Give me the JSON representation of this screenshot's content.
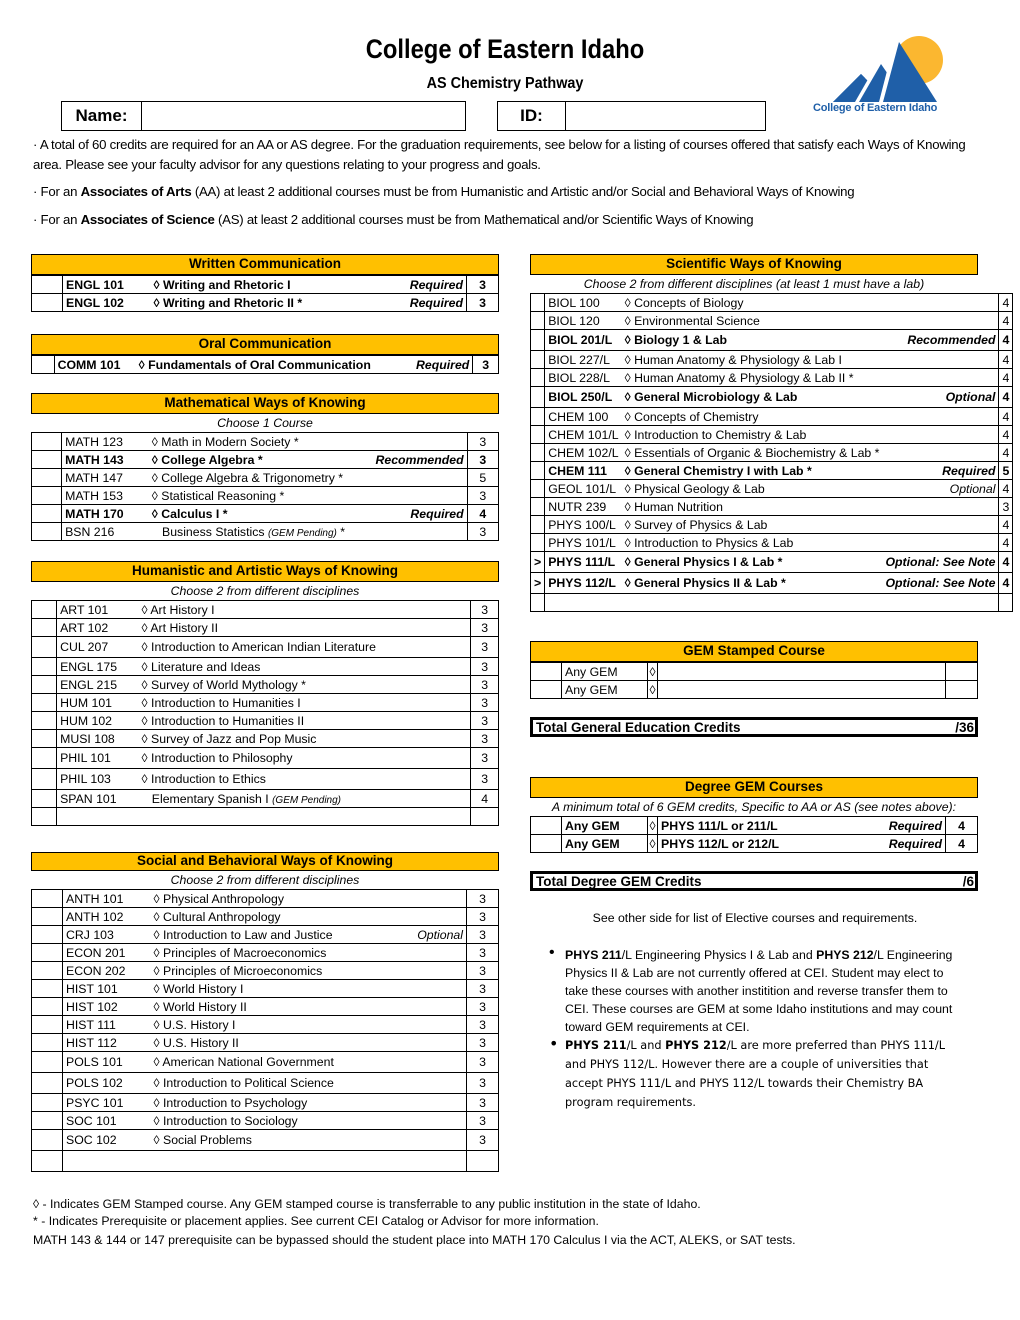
{
  "header": {
    "title": "College of Eastern Idaho",
    "subtitle": "AS Chemistry Pathway",
    "logo_text": "College of Eastern Idaho",
    "name_label": "Name:",
    "name_value": "",
    "id_label": "ID:",
    "id_value": ""
  },
  "intro": {
    "line1": "· A total of 60 credits are required for an AA or AS degree. For the graduation requirements, see below for a listing of courses offered that satisfy each Ways of Knowing area. Please see your faculty advisor for any questions relating to your progress and goals.",
    "aa_prefix": "· For an ",
    "aa_bold": "Associates of Arts",
    "aa_rest": " (AA) at least 2 additional courses must be from Humanistic and Artistic and/or Social and Behavioral Ways of Knowing",
    "as_prefix": "· For an ",
    "as_bold": "Associates of Science",
    "as_rest": " (AS) at least 2 additional courses must be from  Mathematical and/or Scientific Ways of Knowing"
  },
  "gem_symbol": "◊",
  "colors": {
    "header_fill": "#ffc000",
    "logo_blue": "#1f5fa8",
    "logo_sun": "#fbb730"
  },
  "written": {
    "title": "Written Communication",
    "rows": [
      {
        "code": "ENGL 101",
        "gem": true,
        "name": "Writing and Rhetoric I",
        "status": "Required",
        "credits": "3",
        "bold": true
      },
      {
        "code": "ENGL 102",
        "gem": true,
        "name": "Writing and Rhetoric II *",
        "status": "Required",
        "credits": "3",
        "bold": true
      }
    ]
  },
  "oral": {
    "title": "Oral Communication",
    "rows": [
      {
        "code": "COMM 101",
        "gem": true,
        "name": "Fundamentals of Oral Communication",
        "status": "Required",
        "credits": "3",
        "bold": true
      }
    ]
  },
  "math": {
    "title": "Mathematical Ways of Knowing",
    "note": "Choose 1 Course",
    "rows": [
      {
        "code": "MATH 123",
        "gem": true,
        "name": "Math in Modern Society *",
        "status": "",
        "credits": "3",
        "bold": false
      },
      {
        "code": "MATH 143",
        "gem": true,
        "name": "College Algebra *",
        "status": "Recommended",
        "credits": "3",
        "bold": true
      },
      {
        "code": "MATH 147",
        "gem": true,
        "name": "College Algebra & Trigonometry *",
        "status": "",
        "credits": "5",
        "bold": false
      },
      {
        "code": "MATH 153",
        "gem": true,
        "name": "Statistical Reasoning *",
        "status": "",
        "credits": "3",
        "bold": false
      },
      {
        "code": "MATH 170",
        "gem": true,
        "name": "Calculus I *",
        "status": "Required",
        "credits": "4",
        "bold": true
      },
      {
        "code": "BSN 216",
        "gem": false,
        "name": "Business Statistics",
        "pending": "(GEM Pending)",
        "suffix": " *",
        "status": "",
        "credits": "3",
        "bold": false
      }
    ]
  },
  "humanistic": {
    "title": "Humanistic and Artistic Ways of Knowing",
    "note": "Choose 2 from different disciplines",
    "rows": [
      {
        "code": "ART 101",
        "gem": true,
        "name": "Art History I",
        "status": "",
        "credits": "3"
      },
      {
        "code": "ART 102",
        "gem": true,
        "name": "Art History II",
        "status": "",
        "credits": "3"
      },
      {
        "code": "CUL 207",
        "gem": true,
        "name": "Introduction to American Indian Literature",
        "status": "",
        "credits": "3",
        "tall": true
      },
      {
        "code": "ENGL 175",
        "gem": true,
        "name": "Literature and Ideas",
        "status": "",
        "credits": "3"
      },
      {
        "code": "ENGL 215",
        "gem": true,
        "name": "Survey of World Mythology *",
        "status": "",
        "credits": "3"
      },
      {
        "code": "HUM 101",
        "gem": true,
        "name": "Introduction to Humanities I",
        "status": "",
        "credits": "3"
      },
      {
        "code": "HUM 102",
        "gem": true,
        "name": "Introduction to Humanities II",
        "status": "",
        "credits": "3"
      },
      {
        "code": "MUSI 108",
        "gem": true,
        "name": "Survey of Jazz and Pop Music",
        "status": "",
        "credits": "3"
      },
      {
        "code": "PHIL 101",
        "gem": true,
        "name": "Introduction to Philosophy",
        "status": "",
        "credits": "3",
        "tall": true
      },
      {
        "code": "PHIL 103",
        "gem": true,
        "name": "Introduction to Ethics",
        "status": "",
        "credits": "3",
        "tall": true
      },
      {
        "code": "SPAN 101",
        "gem": false,
        "name": "Elementary Spanish I",
        "pending": "(GEM Pending)",
        "suffix": "",
        "status": "",
        "credits": "4"
      },
      {
        "code": "",
        "gem": false,
        "name": "",
        "status": "",
        "credits": ""
      }
    ]
  },
  "social": {
    "title": "Social and Behavioral Ways of Knowing",
    "note": "Choose 2 from different disciplines",
    "rows": [
      {
        "code": "ANTH 101",
        "gem": true,
        "name": "Physical Anthropology",
        "status": "",
        "credits": "3"
      },
      {
        "code": "ANTH 102",
        "gem": true,
        "name": "Cultural Anthropology",
        "status": "",
        "credits": "3"
      },
      {
        "code": "CRJ 103",
        "gem": true,
        "name": "Introduction to Law and Justice",
        "status": "Optional",
        "credits": "3"
      },
      {
        "code": "ECON 201",
        "gem": true,
        "name": "Principles of Macroeconomics",
        "status": "",
        "credits": "3"
      },
      {
        "code": "ECON 202",
        "gem": true,
        "name": "Principles of Microeconomics",
        "status": "",
        "credits": "3"
      },
      {
        "code": "HIST 101",
        "gem": true,
        "name": "World History I",
        "status": "",
        "credits": "3"
      },
      {
        "code": "HIST 102",
        "gem": true,
        "name": "World History II",
        "status": "",
        "credits": "3"
      },
      {
        "code": "HIST 111",
        "gem": true,
        "name": "U.S. History I",
        "status": "",
        "credits": "3"
      },
      {
        "code": "HIST 112",
        "gem": true,
        "name": "U.S. History II",
        "status": "",
        "credits": "3"
      },
      {
        "code": "POLS 101",
        "gem": true,
        "name": "American National Government",
        "status": "",
        "credits": "3",
        "tall": true
      },
      {
        "code": "POLS 102",
        "gem": true,
        "name": "Introduction to Political Science",
        "status": "",
        "credits": "3",
        "tall": true
      },
      {
        "code": "PSYC 101",
        "gem": true,
        "name": "Introduction to Psychology",
        "status": "",
        "credits": "3"
      },
      {
        "code": "SOC 101",
        "gem": true,
        "name": "Introduction to Sociology",
        "status": "",
        "credits": "3"
      },
      {
        "code": "SOC 102",
        "gem": true,
        "name": "Social Problems",
        "status": "",
        "credits": "3",
        "tall": true
      },
      {
        "code": "",
        "gem": false,
        "name": "",
        "status": "",
        "credits": "",
        "tall": true
      }
    ]
  },
  "scientific": {
    "title": "Scientific Ways of Knowing",
    "note": "Choose 2 from different disciplines (at least 1 must have a lab)",
    "rows": [
      {
        "mark": "",
        "code": "BIOL 100",
        "gem": true,
        "name": "Concepts of Biology",
        "status": "",
        "credits": "4"
      },
      {
        "mark": "",
        "code": "BIOL 120",
        "gem": true,
        "name": "Environmental Science",
        "status": "",
        "credits": "4"
      },
      {
        "mark": "",
        "code": "BIOL 201/L",
        "gem": true,
        "name": "Biology 1 & Lab",
        "status": "Recommended",
        "credits": "4",
        "bold": true,
        "tall": true
      },
      {
        "mark": "",
        "code": "BIOL 227/L",
        "gem": true,
        "name": "Human Anatomy & Physiology & Lab I",
        "status": "",
        "credits": "4"
      },
      {
        "mark": "",
        "code": "BIOL 228/L",
        "gem": true,
        "name": "Human Anatomy & Physiology & Lab II *",
        "status": "",
        "credits": "4"
      },
      {
        "mark": "",
        "code": "BIOL 250/L",
        "gem": true,
        "name": "General Microbiology & Lab",
        "status": "Optional",
        "credits": "4",
        "bold": true,
        "tall": true
      },
      {
        "mark": "",
        "code": "CHEM 100",
        "gem": true,
        "name": "Concepts of Chemistry",
        "status": "",
        "credits": "4"
      },
      {
        "mark": "",
        "code": "CHEM 101/L",
        "gem": true,
        "name": "Introduction to Chemistry & Lab",
        "status": "",
        "credits": "4"
      },
      {
        "mark": "",
        "code": "CHEM 102/L",
        "gem": true,
        "name": "Essentials of Organic & Biochemistry & Lab *",
        "status": "",
        "credits": "4"
      },
      {
        "mark": "",
        "code": "CHEM 111",
        "gem": true,
        "name": "General Chemistry I with Lab *",
        "status": "Required",
        "credits": "5",
        "bold": true
      },
      {
        "mark": "",
        "code": "GEOL 101/L",
        "gem": true,
        "name": "Physical Geology & Lab",
        "status": "Optional",
        "credits": "4"
      },
      {
        "mark": "",
        "code": "NUTR 239",
        "gem": true,
        "name": "Human Nutrition",
        "status": "",
        "credits": "3"
      },
      {
        "mark": "",
        "code": "PHYS 100/L",
        "gem": true,
        "name": "Survey of Physics & Lab",
        "status": "",
        "credits": "4"
      },
      {
        "mark": "",
        "code": "PHYS 101/L",
        "gem": true,
        "name": "Introduction to Physics & Lab",
        "status": "",
        "credits": "4"
      },
      {
        "mark": ">",
        "code": "PHYS 111/L",
        "gem": true,
        "name": "General Physics I & Lab *",
        "status": "Optional: See Note",
        "credits": "4",
        "bold": true,
        "tall": true
      },
      {
        "mark": ">",
        "code": "PHYS 112/L",
        "gem": true,
        "name": "General Physics II & Lab *",
        "status": "Optional: See Note",
        "credits": "4",
        "bold": true,
        "tall": true
      },
      {
        "mark": "",
        "code": "",
        "gem": false,
        "name": "",
        "status": "",
        "credits": ""
      }
    ]
  },
  "gem_stamped": {
    "title": "GEM Stamped Course",
    "rows": [
      {
        "code": "Any GEM",
        "name": "",
        "status": "",
        "credits": ""
      },
      {
        "code": "Any GEM",
        "name": "",
        "status": "",
        "credits": ""
      }
    ]
  },
  "total_gen_ed": {
    "label": "Total General Education Credits",
    "value": "/36"
  },
  "degree_gem": {
    "title": "Degree GEM Courses",
    "note": "A minimum total of 6 GEM credits, Specific to AA or AS (see notes above):",
    "rows": [
      {
        "code": "Any GEM",
        "name": "PHYS 111/L or 211/L",
        "status": "Required",
        "credits": "4"
      },
      {
        "code": "Any GEM",
        "name": "PHYS 112/L or 212/L",
        "status": "Required",
        "credits": "4"
      }
    ]
  },
  "total_degree_gem": {
    "label": "Total Degree GEM Credits",
    "value": "/6"
  },
  "see_other": "See other side for list of Elective courses and requirements.",
  "notes": {
    "b1_bold1": "PHYS 211",
    "b1_t1": "/L Engineering Physics I & Lab and ",
    "b1_bold2": "PHYS 212",
    "b1_t2": "/L Engineering Physics II & Lab are not currently offered at CEI. Student may elect to take these courses with another institition and reverse transfer them to CEI. These courses are GEM at some Idaho institutions and may count toward GEM requirements at CEI.",
    "b2_bold1": "PHYS 211",
    "b2_t1": "/L and ",
    "b2_bold2": "PHYS 212",
    "b2_t2": "/L are more preferred than PHYS 111/L and PHYS 112/L. However there are a couple of universities that accept PHYS 111/L and PHYS 112/L towards their Chemistry BA program requirements."
  },
  "footer": {
    "line1": "◊ - Indicates GEM Stamped course. Any GEM stamped course is transferrable to any public institution in the state of Idaho.",
    "line2": "* - Indicates Prerequisite or placement applies. See current CEI Catalog or Advisor for more information.",
    "line3": "MATH 143 & 144 or 147 prerequisite can be bypassed should the student place into MATH 170 Calculus I via the ACT, ALEKS, or SAT tests."
  }
}
